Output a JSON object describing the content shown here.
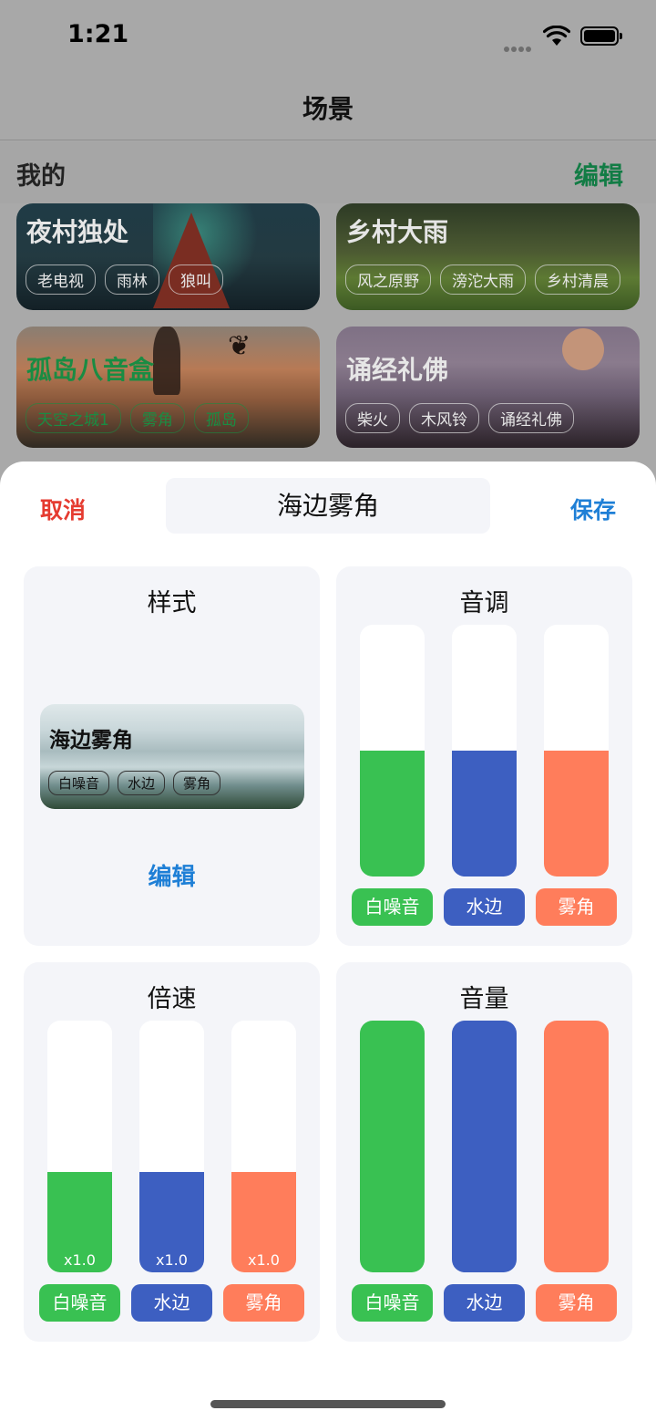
{
  "status": {
    "time": "1:21"
  },
  "nav": {
    "title": "场景"
  },
  "section": {
    "mine": "我的",
    "edit": "编辑"
  },
  "scenes": [
    {
      "title": "夜村独处",
      "tags": [
        "老电视",
        "雨林",
        "狼叫"
      ]
    },
    {
      "title": "乡村大雨",
      "tags": [
        "风之原野",
        "滂沱大雨",
        "乡村清晨"
      ]
    },
    {
      "title": "孤岛八音盒",
      "tags": [
        "天空之城1",
        "雾角",
        "孤岛"
      ]
    },
    {
      "title": "诵经礼佛",
      "tags": [
        "柴火",
        "木风铃",
        "诵经礼佛"
      ]
    }
  ],
  "sheet": {
    "cancel": "取消",
    "save": "保存",
    "name": "海边雾角",
    "style": {
      "title": "样式",
      "preview_title": "海边雾角",
      "preview_tags": [
        "白噪音",
        "水边",
        "雾角"
      ],
      "edit": "编辑"
    },
    "tone": {
      "title": "音调",
      "channels": [
        {
          "label": "白噪音",
          "color": "#39c152",
          "level": 0.5
        },
        {
          "label": "水边",
          "color": "#3d5fc1",
          "level": 0.5
        },
        {
          "label": "雾角",
          "color": "#ff7d5b",
          "level": 0.5
        }
      ]
    },
    "speed": {
      "title": "倍速",
      "channels": [
        {
          "label": "白噪音",
          "color": "#39c152",
          "level": 0.4,
          "value": "x1.0"
        },
        {
          "label": "水边",
          "color": "#3d5fc1",
          "level": 0.4,
          "value": "x1.0"
        },
        {
          "label": "雾角",
          "color": "#ff7d5b",
          "level": 0.4,
          "value": "x1.0"
        }
      ]
    },
    "volume": {
      "title": "音量",
      "channels": [
        {
          "label": "白噪音",
          "color": "#39c152",
          "level": 1.0
        },
        {
          "label": "水边",
          "color": "#3d5fc1",
          "level": 1.0
        },
        {
          "label": "雾角",
          "color": "#ff7d5b",
          "level": 1.0
        }
      ]
    }
  }
}
